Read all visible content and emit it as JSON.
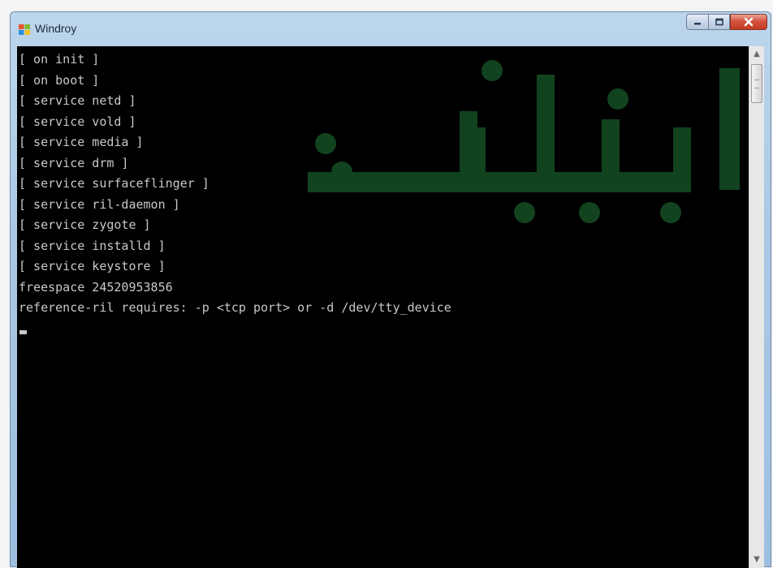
{
  "window": {
    "title": "Windroy"
  },
  "colors": {
    "console_background": "#000000",
    "console_text": "#c8c8c8",
    "watermark_green": "#1f7a3a",
    "close_button": "#d6533f"
  },
  "icons": {
    "app": "windroy-app-icon",
    "minimize": "minimize-icon",
    "maximize": "maximize-icon",
    "close": "close-icon",
    "scroll_up": "scroll-up-icon",
    "scroll_down": "scroll-down-icon"
  },
  "console": {
    "lines": [
      "[ on init ]",
      "[ on boot ]",
      "[ service netd ]",
      "[ service vold ]",
      "[ service media ]",
      "[ service drm ]",
      "[ service surfaceflinger ]",
      "[ service ril-daemon ]",
      "[ service zygote ]",
      "[ service installd ]",
      "[ service keystore ]",
      "freespace 24520953856",
      "reference-ril requires: -p <tcp port> or -d /dev/tty_device"
    ]
  }
}
